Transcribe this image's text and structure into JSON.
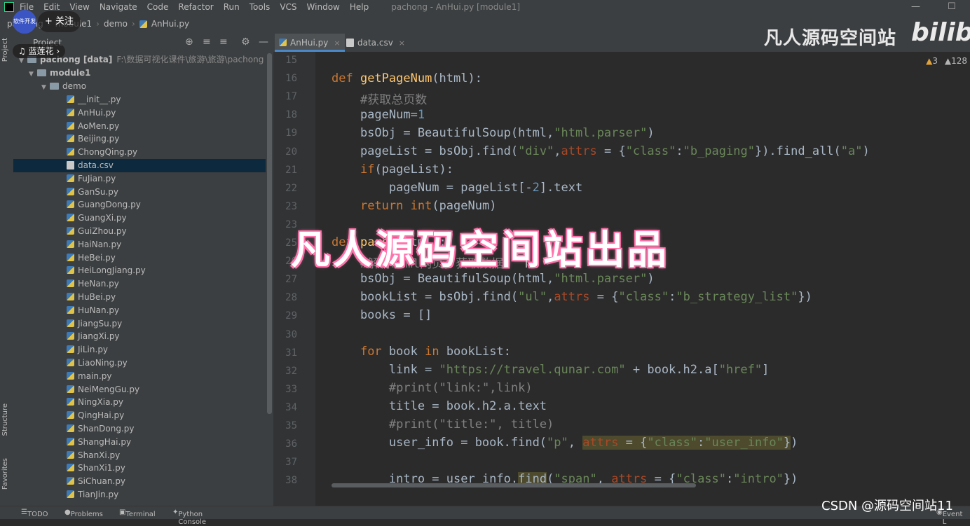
{
  "menubar": {
    "items": [
      "File",
      "Edit",
      "View",
      "Navigate",
      "Code",
      "Refactor",
      "Run",
      "Tools",
      "VCS",
      "Window",
      "Help"
    ],
    "window_title": "pachong - AnHui.py [module1]"
  },
  "breadcrumb": [
    "pachong",
    "module1",
    "demo",
    "AnHui.py"
  ],
  "project_panel": {
    "title": "Project",
    "root": "pachong [data]",
    "root_path": "F:\\数据可视化课件\\旅游\\旅游\\pachong",
    "module": "module1",
    "folder": "demo",
    "files": [
      "__init__.py",
      "AnHui.py",
      "AoMen.py",
      "Beijing.py",
      "ChongQing.py",
      "data.csv",
      "FuJian.py",
      "GanSu.py",
      "GuangDong.py",
      "GuangXi.py",
      "GuiZhou.py",
      "HaiNan.py",
      "HeBei.py",
      "HeiLongJiang.py",
      "HeNan.py",
      "HuBei.py",
      "HuNan.py",
      "JiangSu.py",
      "JiangXi.py",
      "JiLin.py",
      "LiaoNing.py",
      "main.py",
      "NeiMengGu.py",
      "NingXia.py",
      "QingHai.py",
      "ShanDong.py",
      "ShangHai.py",
      "ShanXi.py",
      "ShanXi1.py",
      "SiChuan.py",
      "TianJin.py"
    ],
    "selected": "data.csv"
  },
  "tabs": [
    {
      "label": "AnHui.py",
      "active": true
    },
    {
      "label": "data.csv",
      "active": false
    }
  ],
  "inspections": {
    "warnings": "3",
    "weak_warnings": "128"
  },
  "side_labels": {
    "project": "Project",
    "structure": "Structure",
    "favorites": "Favorites"
  },
  "code_lines": [
    {
      "n": "15"
    },
    {
      "n": "16"
    },
    {
      "n": "17"
    },
    {
      "n": "18"
    },
    {
      "n": "19"
    },
    {
      "n": "20"
    },
    {
      "n": "21"
    },
    {
      "n": "22"
    },
    {
      "n": "23"
    },
    {
      "n": "23"
    },
    {
      "n": "25"
    },
    {
      "n": "26"
    },
    {
      "n": "27"
    },
    {
      "n": "28"
    },
    {
      "n": "29"
    },
    {
      "n": "30"
    },
    {
      "n": "31"
    },
    {
      "n": "32"
    },
    {
      "n": "33"
    },
    {
      "n": "34"
    },
    {
      "n": "35"
    },
    {
      "n": "36"
    },
    {
      "n": "37"
    },
    {
      "n": "38"
    }
  ],
  "bottom_tools": [
    "TODO",
    "Problems",
    "Terminal",
    "Python Console",
    "Event L"
  ],
  "overlays": {
    "site_watermark": "凡人源码空间站",
    "big_watermark": "凡人源码空间站出品",
    "bili": "bilib",
    "csdn": "CSDN @源码空间站11",
    "avatar_text": "软件开发",
    "follow": "+ 关注",
    "music": "♫ 蓝莲花 ›"
  },
  "colors": {
    "keyword": "#cc7832",
    "function": "#ffc66d",
    "string": "#6a8759",
    "number": "#6897bb",
    "comment": "#808080",
    "param": "#aa4926"
  }
}
